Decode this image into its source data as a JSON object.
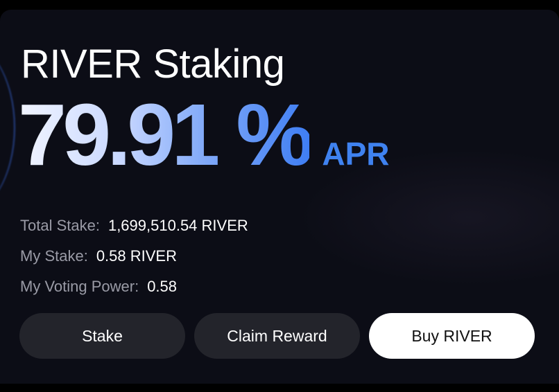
{
  "header": {
    "title": "RIVER Staking"
  },
  "apr": {
    "value": "79.91 %",
    "unit": "APR"
  },
  "stats": {
    "total_stake_label": "Total Stake:",
    "total_stake_value": "1,699,510.54 RIVER",
    "my_stake_label": "My Stake:",
    "my_stake_value": "0.58 RIVER",
    "voting_power_label": "My Voting Power:",
    "voting_power_value": "0.58"
  },
  "actions": {
    "stake_label": "Stake",
    "claim_label": "Claim Reward",
    "buy_label": "Buy RIVER"
  },
  "colors": {
    "background": "#0c0d16",
    "accent": "#3f82f0",
    "button_dark": "#23242b",
    "button_light": "#ffffff"
  }
}
